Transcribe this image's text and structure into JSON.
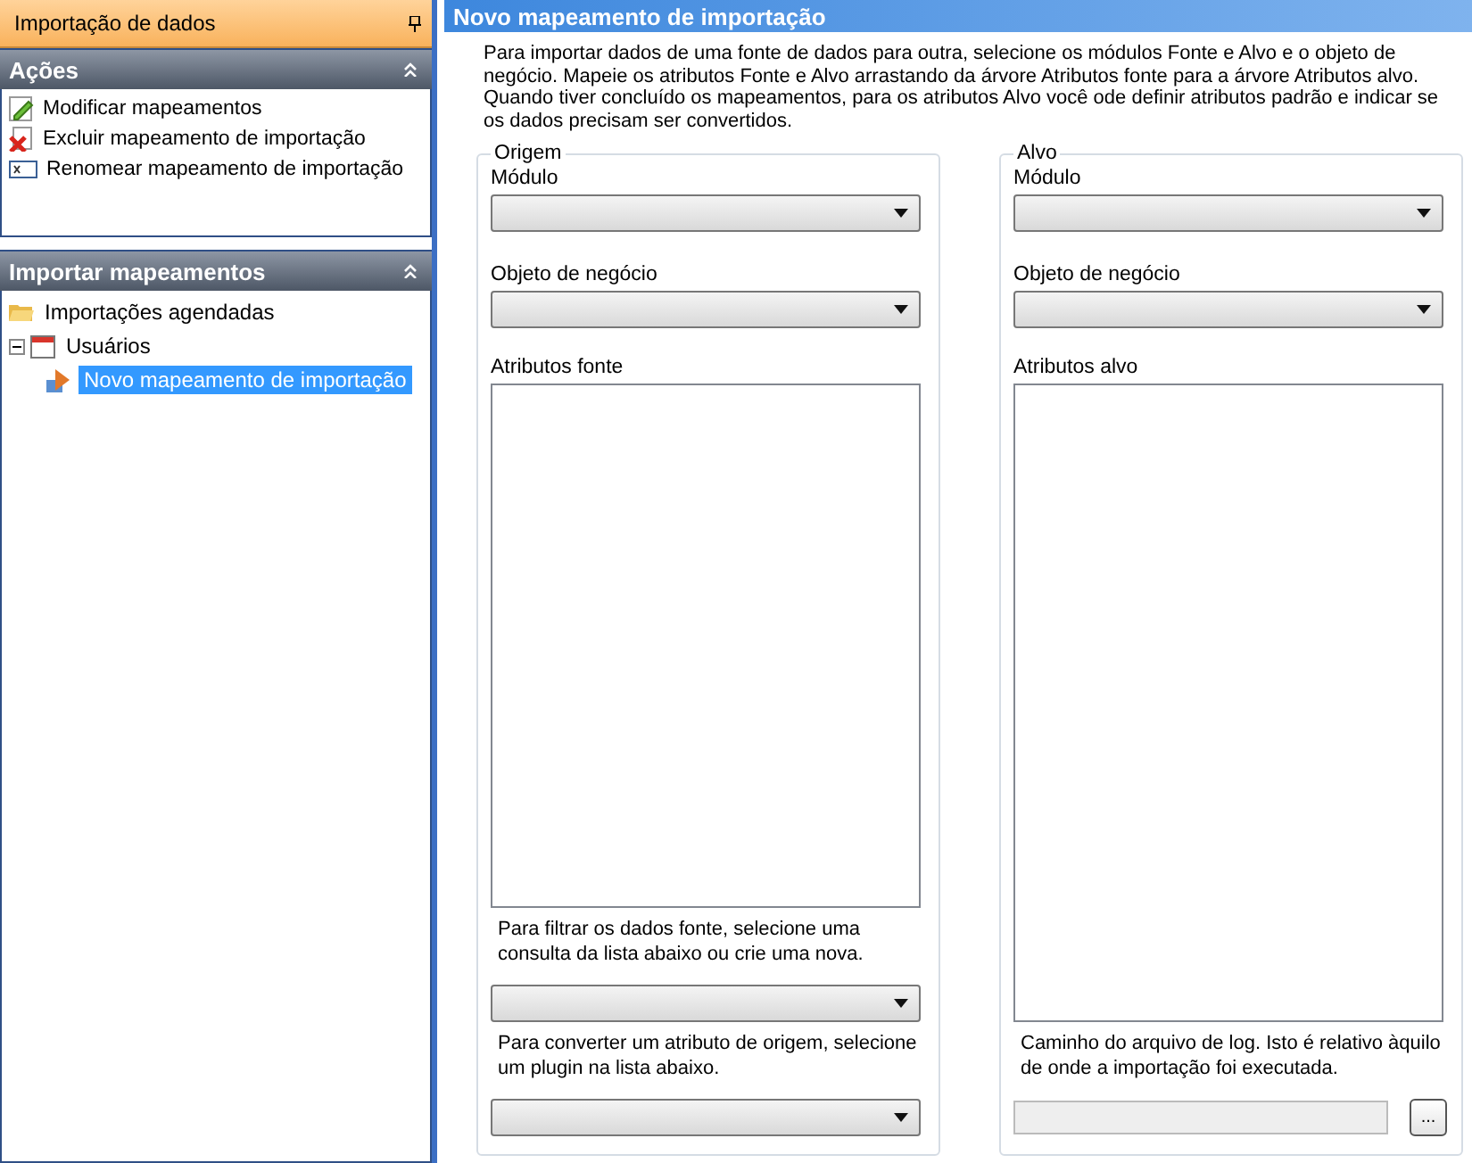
{
  "left_pane": {
    "title": "Importação de dados",
    "sections": [
      {
        "title": "Ações",
        "expanded": true,
        "kind": "actions",
        "items": [
          {
            "label": "Modificar mapeamentos",
            "kind": "edit"
          },
          {
            "label": "Excluir mapeamento de importação",
            "kind": "delete"
          },
          {
            "label": "Renomear mapeamento de importação",
            "kind": "rename"
          }
        ]
      },
      {
        "title": "Importar mapeamentos",
        "expanded": true,
        "kind": "tree",
        "items": [
          {
            "label": "Importações agendadas",
            "kind": "folder",
            "selected": false
          },
          {
            "label": "Usuários",
            "kind": "calendar",
            "selected": false,
            "expanded": true,
            "children": [
              {
                "label": "Novo mapeamento de importação",
                "kind": "mapping",
                "selected": true
              }
            ]
          }
        ]
      }
    ]
  },
  "main": {
    "title": "Novo mapeamento de importação",
    "description": "Para importar dados de uma fonte de dados para outra, selecione os módulos Fonte e Alvo e o objeto de negócio. Mapeie os atributos Fonte e Alvo arrastando da árvore Atributos fonte para a árvore Atributos alvo. Quando tiver concluído os mapeamentos, para os atributos Alvo você ode definir atributos padrão e indicar se os dados precisam ser convertidos.",
    "groups": [
      {
        "title": "Origem",
        "module_label": "Módulo",
        "object_label": "Objeto de negócio",
        "attributes_label": "Atributos fonte",
        "bottom": [
          {
            "kind": "note",
            "text": "Para filtrar os dados fonte, selecione uma consulta da lista abaixo ou crie uma nova."
          },
          {
            "kind": "dropdown"
          },
          {
            "kind": "note",
            "text": "Para converter um atributo de origem, selecione um plugin na lista abaixo."
          },
          {
            "kind": "dropdown"
          }
        ]
      },
      {
        "title": "Alvo",
        "module_label": "Módulo",
        "object_label": "Objeto de negócio",
        "attributes_label": "Atributos alvo",
        "bottom": [
          {
            "kind": "note",
            "text": "Caminho do arquivo de log. Isto é relativo àquilo de onde a importação foi executada."
          },
          {
            "kind": "path",
            "button": "..."
          }
        ]
      }
    ]
  }
}
